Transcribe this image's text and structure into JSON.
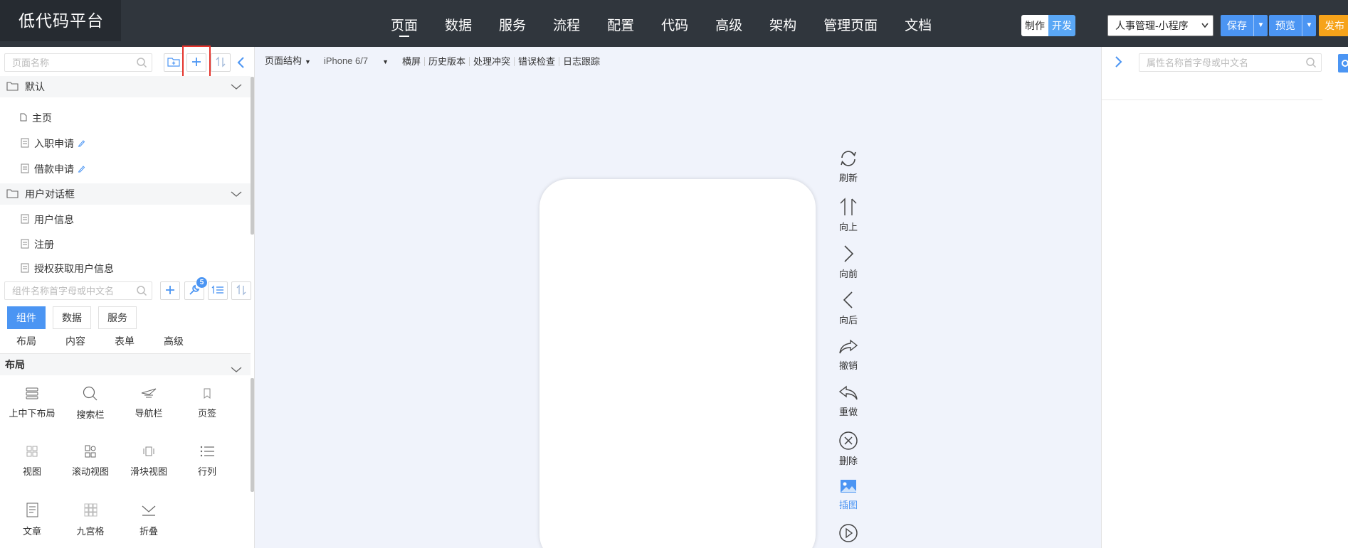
{
  "app": {
    "logo": "低代码平台"
  },
  "nav": {
    "items": [
      "页面",
      "数据",
      "服务",
      "流程",
      "配置",
      "代码",
      "高级",
      "架构",
      "管理页面",
      "文档"
    ]
  },
  "header": {
    "mode_make": "制作",
    "mode_dev": "开发",
    "project": "人事管理-小程序",
    "save": "保存",
    "preview": "预览",
    "publish": "发布"
  },
  "pages_panel": {
    "search_placeholder": "页面名称",
    "groups": [
      {
        "name": "默认",
        "items": [
          "主页",
          "入职申请",
          "借款申请"
        ]
      },
      {
        "name": "用户对话框",
        "items": [
          "用户信息",
          "注册",
          "授权获取用户信息"
        ]
      }
    ]
  },
  "components_panel": {
    "search_placeholder": "组件名称首字母或中文名",
    "badge_count": "5",
    "tabs": [
      "组件",
      "数据",
      "服务"
    ],
    "subtabs": [
      "布局",
      "内容",
      "表单",
      "高级"
    ],
    "section": "布局",
    "items": [
      "上中下布局",
      "搜索栏",
      "导航栏",
      "页签",
      "视图",
      "滚动视图",
      "滑块视图",
      "行列",
      "文章",
      "九宫格",
      "折叠"
    ]
  },
  "canvas_toolbar": {
    "structure": "页面结构",
    "device": "iPhone 6/7",
    "landscape": "横屏",
    "history": "历史版本",
    "conflict": "处理冲突",
    "error_check": "错误检查",
    "log_trace": "日志跟踪"
  },
  "side_tools": [
    "刷新",
    "向上",
    "向前",
    "向后",
    "撤销",
    "重做",
    "删除",
    "插图"
  ],
  "properties_panel": {
    "search_placeholder": "属性名称首字母或中文名"
  },
  "colors": {
    "accent": "#4b95f3",
    "publish": "#f6a31a",
    "topbar": "#30363d",
    "canvas_bg": "#f0f3fb",
    "highlight": "#e4332b"
  }
}
